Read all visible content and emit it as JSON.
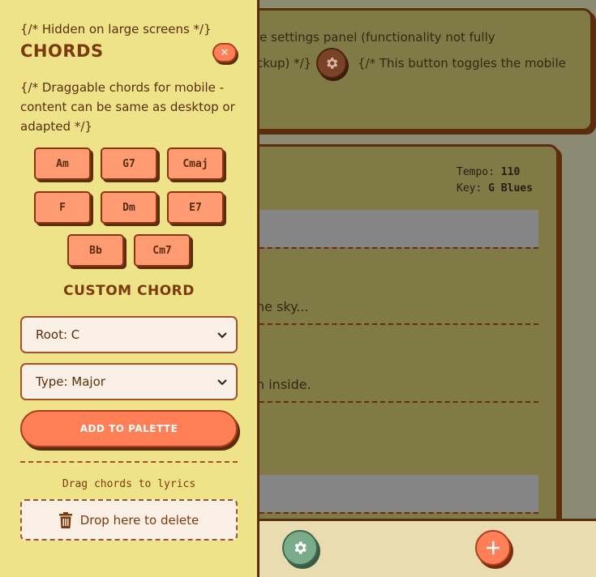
{
  "background": {
    "top_card": {
      "line1": "le settings panel (functionality not fully",
      "line2": "ckup) */}",
      "line3": "{/* This button toggles the mobile"
    },
    "song": {
      "tempo_label": "Tempo:",
      "tempo_value": "110",
      "key_label": "Key:",
      "key_value": "G Blues",
      "lyric1": "he sky...",
      "lyric2": "n inside."
    },
    "bottom_bar": {
      "settings_icon": "gear-icon",
      "add_icon": "plus-icon"
    }
  },
  "drawer": {
    "comment_top": "{/* Hidden on large screens */}",
    "title": "CHORDS",
    "close_icon": "close-icon",
    "comment_mid_line1": "{/* Draggable chords for mobile -",
    "comment_mid_line2": "content can be same as desktop or",
    "comment_mid_line3": "adapted */}",
    "chords": [
      "Am",
      "G7",
      "Cmaj",
      "F",
      "Dm",
      "E7",
      "Bb",
      "Cm7"
    ],
    "custom_chord_title": "CUSTOM CHORD",
    "root_select": "Root: C",
    "type_select": "Type: Major",
    "add_button": "ADD TO PALETTE",
    "drag_hint": "Drag chords to lyrics",
    "drop_zone": "Drop here to delete"
  },
  "colors": {
    "drawer_bg": "#efe38a",
    "accent": "#ff7f56",
    "chord_bg": "#ff9b73",
    "border": "#5a2d0c"
  }
}
